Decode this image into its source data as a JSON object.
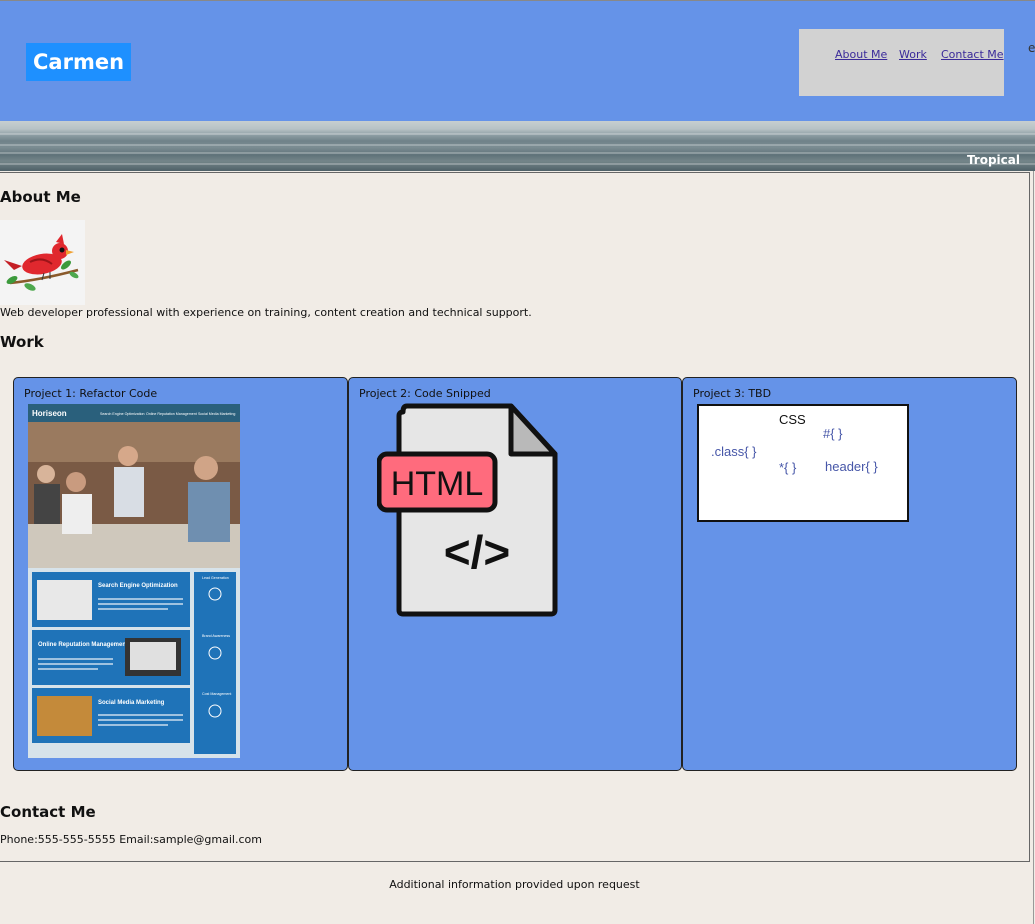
{
  "header": {
    "brand": "Carmen",
    "nav": [
      "About Me",
      "Work",
      "Contact Me"
    ],
    "edge_char": "e"
  },
  "banner": {
    "label": "Tropical"
  },
  "about": {
    "title": "About Me",
    "text": "Web developer professional with experience on training, content creation and technical support."
  },
  "work": {
    "title": "Work",
    "projects": [
      {
        "title": "Project 1: Refactor Code",
        "thumb": {
          "brand": "Horiseon",
          "nav": [
            "Search Engine Optimization",
            "Online Reputation Management",
            "Social Media Marketing"
          ],
          "cards": [
            "Search Engine Optimization",
            "Online Reputation Management",
            "Social Media Marketing"
          ],
          "side": [
            "Lead Generation",
            "Brand Awareness",
            "Cost Management"
          ]
        }
      },
      {
        "title": "Project 2: Code Snipped",
        "icon_text": "HTML",
        "code_glyph": "</>"
      },
      {
        "title": "Project 3: TBD",
        "snippets": [
          "CSS",
          "#{ }",
          ".class{ }",
          "*{ }",
          "header{ }"
        ]
      }
    ]
  },
  "contact": {
    "title": "Contact Me",
    "text": "Phone:555-555-5555 Email:sample@gmail.com"
  },
  "footer": {
    "text": "Additional information provided upon request"
  }
}
